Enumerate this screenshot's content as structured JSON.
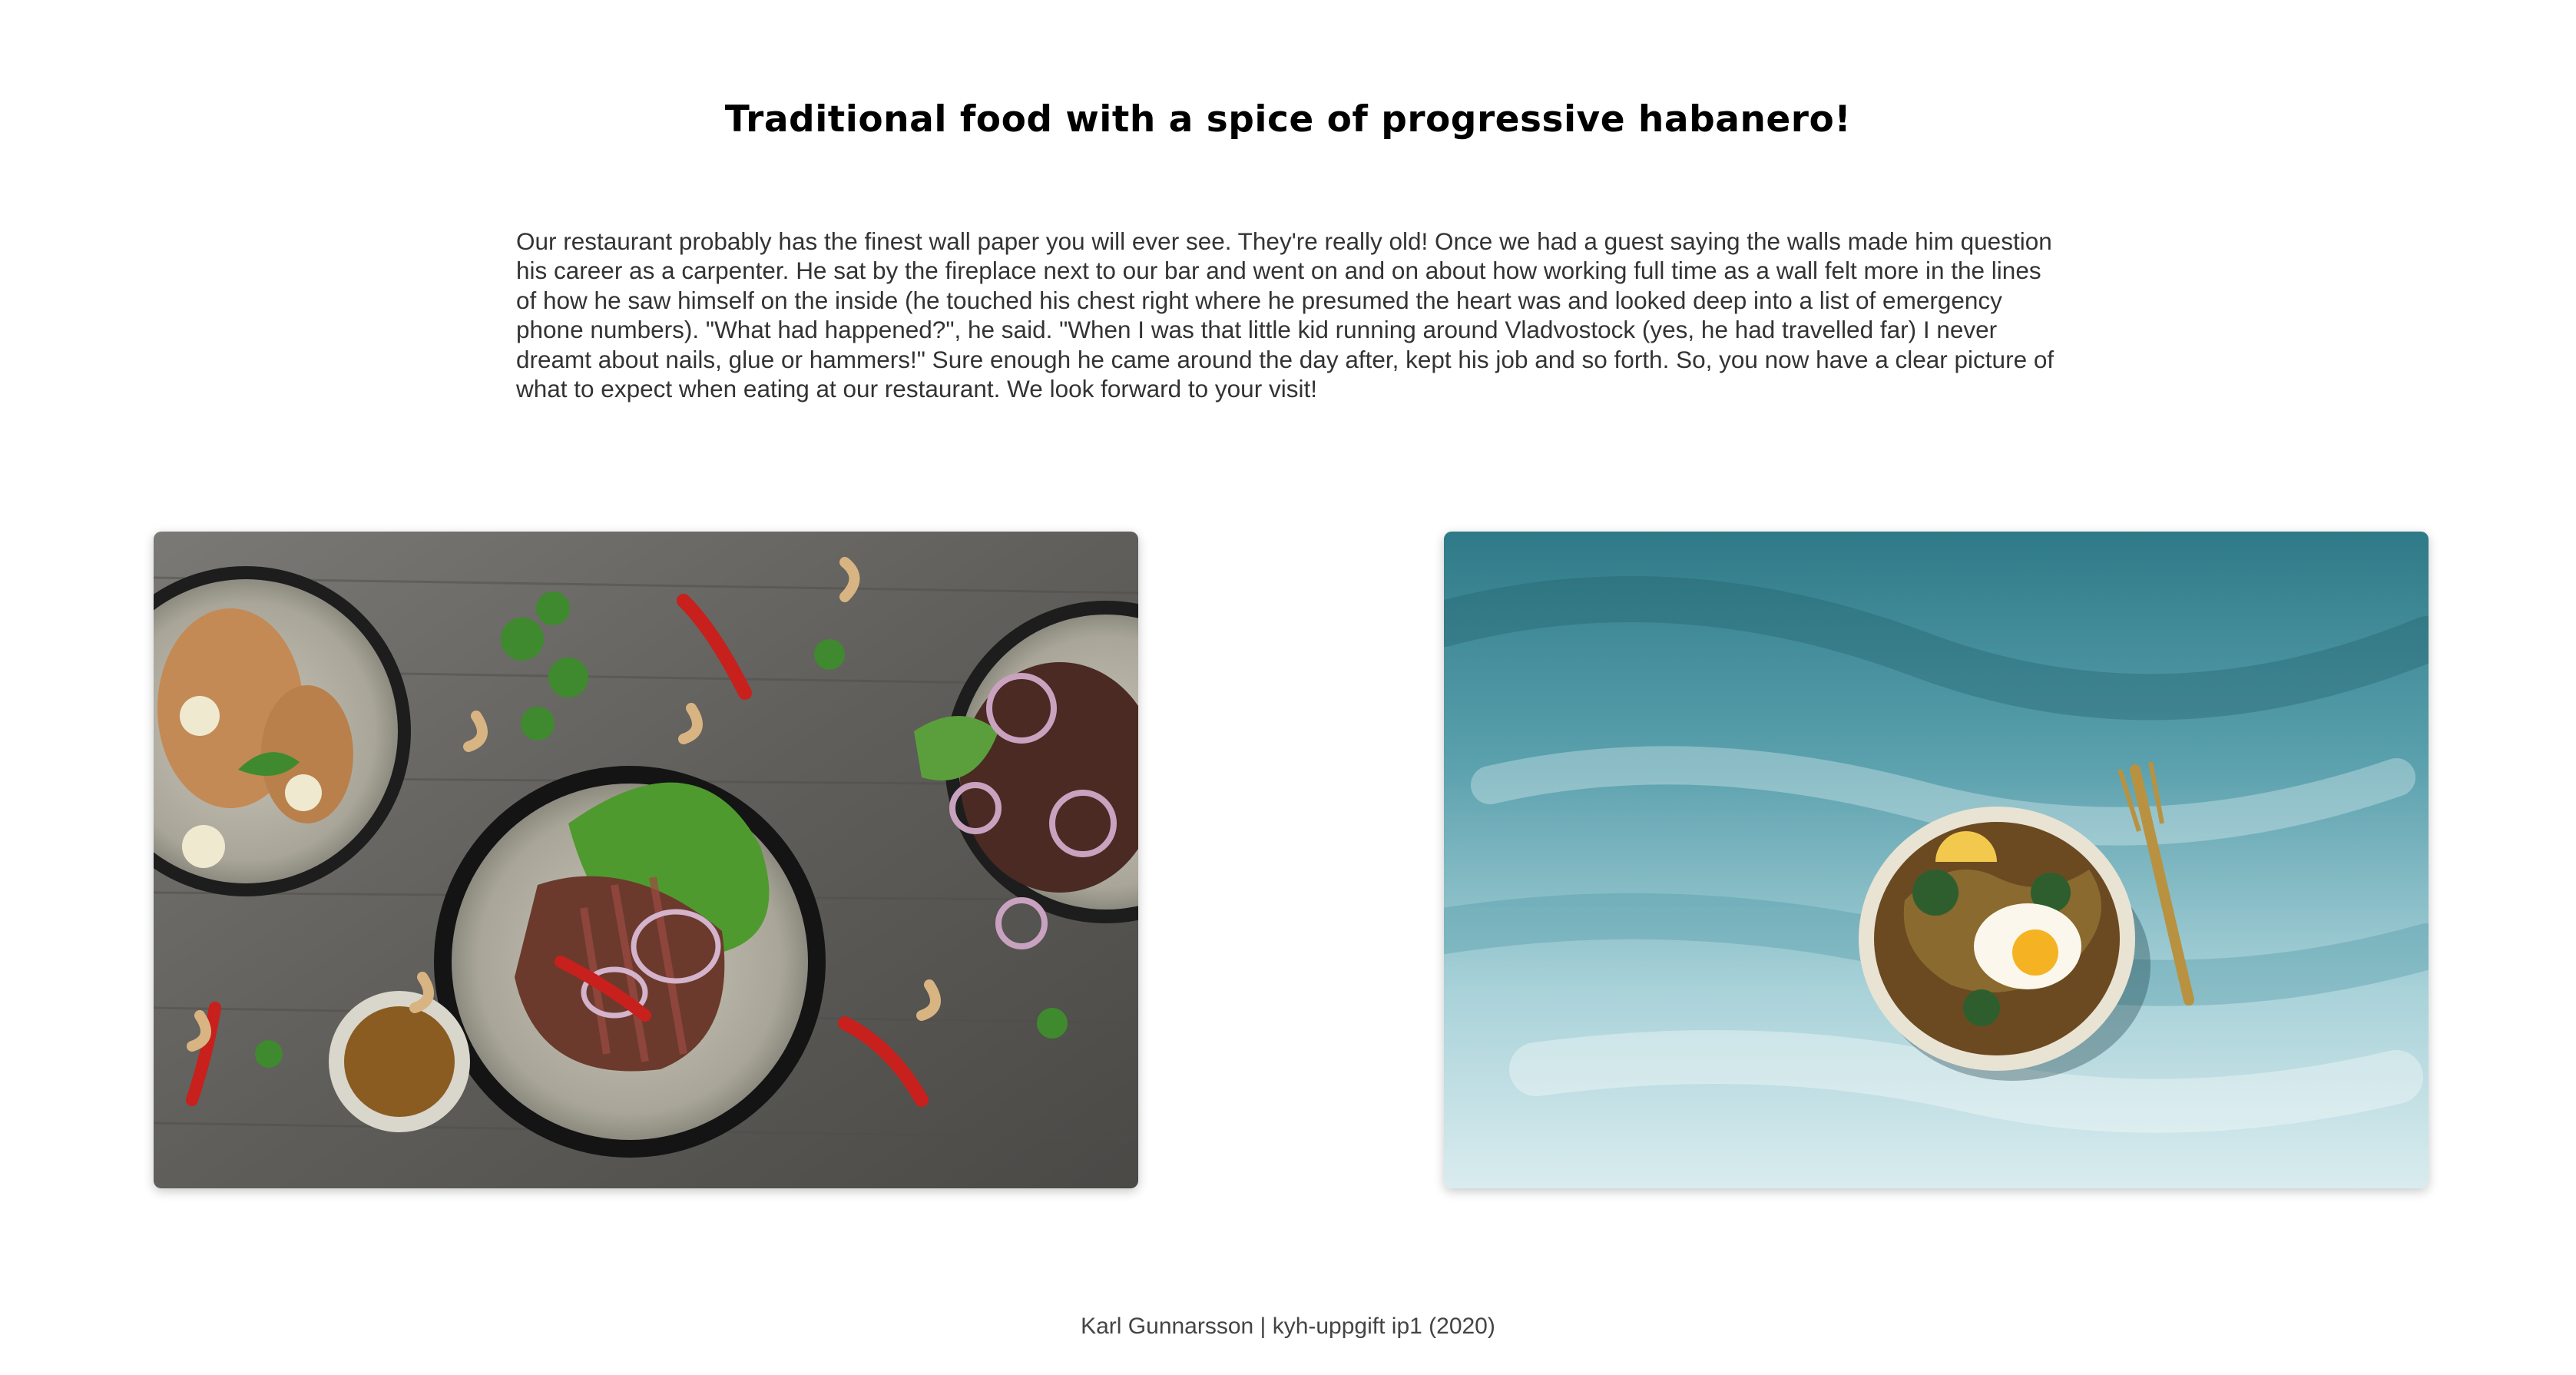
{
  "page": {
    "title": "Traditional food with a spice of progressive habanero!",
    "intro": "Our restaurant probably has the finest wall paper you will ever see. They're really old! Once we had a guest saying the walls made him question his career as a carpenter. He sat by the fireplace next to our bar and went on and on about how working full time as a wall felt more in the lines of how he saw himself on the inside (he touched his chest right where he presumed the heart was and looked deep into a list of emergency phone numbers). \"What had happened?\", he said. \"When I was that little kid running around Vladvostock (yes, he had travelled far) I never dreamt about nails, glue or hammers!\" Sure enough he came around the day after, kept his job and so forth. So, you now have a clear picture of what to expect when eating at our restaurant. We look forward to your visit!"
  },
  "gallery": {
    "images": [
      {
        "name": "food-bowls-on-wood-table-image",
        "colors": {
          "wood": "#6b6b68",
          "bowl": "#b7b4a8",
          "rim": "#1e1e1e",
          "chili": "#c8201c",
          "greens": "#3f8a2e",
          "meat": "#5a2a22"
        }
      },
      {
        "name": "noodle-bowl-on-teal-background-image",
        "colors": {
          "teal": "#3f8a98",
          "light": "#d9ecef",
          "bowl": "#e9e3d3",
          "egg": "#f5b323",
          "fork": "#b89240"
        }
      }
    ]
  },
  "footer": {
    "text": "Karl Gunnarsson | kyh-uppgift ip1  (2020)"
  }
}
